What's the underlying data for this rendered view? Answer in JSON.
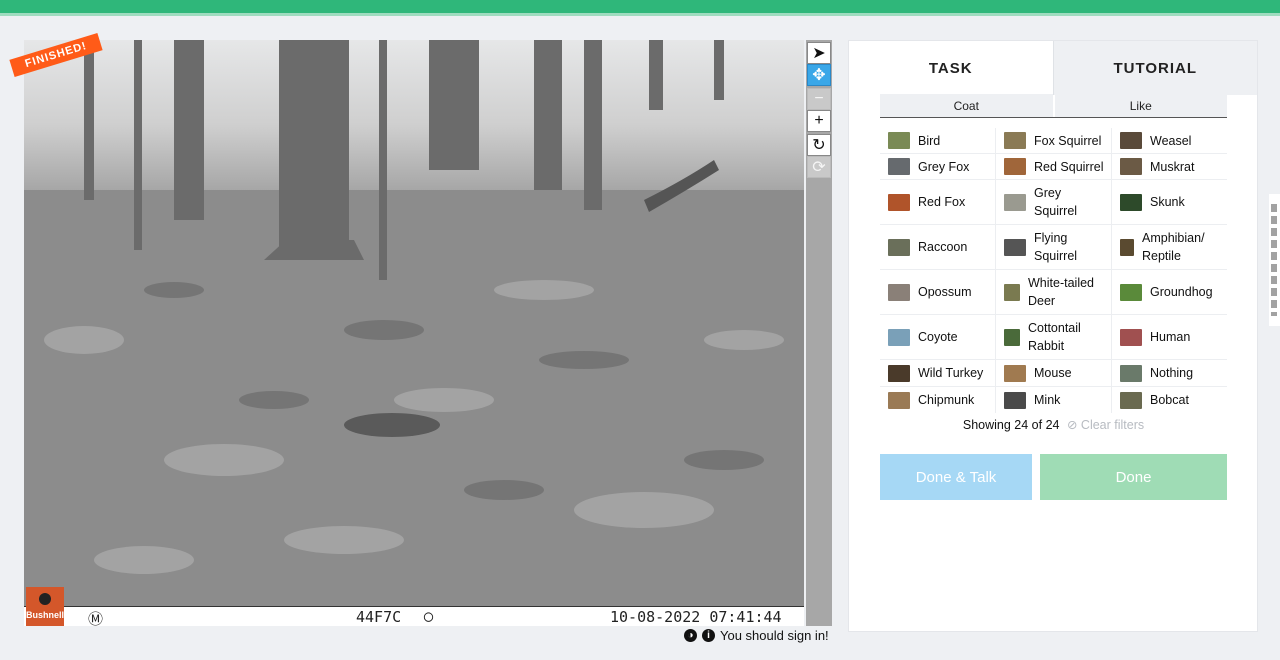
{
  "badge": {
    "finished": "FINISHED!"
  },
  "camera": {
    "brand": "Bushnell",
    "moon_left": "Ⓜ",
    "code": "44F7C",
    "moon_right": "◯",
    "timestamp": "10-08-2022 07:41:44"
  },
  "toolbar": {
    "tools": [
      {
        "name": "pointer-tool",
        "icon": "arrow-pointer-icon",
        "glyph": "➤",
        "state": "normal"
      },
      {
        "name": "move-tool",
        "icon": "move-icon",
        "glyph": "✥",
        "state": "active"
      },
      {
        "name": "zoom-out-tool",
        "icon": "minus-icon",
        "glyph": "−",
        "state": "disabled"
      },
      {
        "name": "zoom-in-tool",
        "icon": "plus-icon",
        "glyph": "+",
        "state": "normal"
      },
      {
        "name": "rotate-tool",
        "icon": "rotate-icon",
        "glyph": "↻",
        "state": "normal"
      },
      {
        "name": "reset-tool",
        "icon": "reset-icon",
        "glyph": "⟳",
        "state": "disabled"
      }
    ]
  },
  "footer": {
    "contrast_icon": "◑",
    "info_icon": "i",
    "signin": "You should sign in!"
  },
  "tabs": {
    "task": "TASK",
    "tutorial": "TUTORIAL"
  },
  "filters": {
    "coat": "Coat",
    "like": "Like"
  },
  "species": [
    [
      {
        "label": "Bird",
        "color": "#7a8a55"
      },
      {
        "label": "Fox Squirrel",
        "color": "#8a7a55"
      },
      {
        "label": "Weasel",
        "color": "#5a4a3a"
      }
    ],
    [
      {
        "label": "Grey Fox",
        "color": "#666a6e"
      },
      {
        "label": "Red Squirrel",
        "color": "#a0663a"
      },
      {
        "label": "Muskrat",
        "color": "#6b5a45"
      }
    ],
    [
      {
        "label": "Red Fox",
        "color": "#b0542a"
      },
      {
        "label": "Grey Squirrel",
        "color": "#9a9a90"
      },
      {
        "label": "Skunk",
        "color": "#2d4a2a"
      }
    ],
    [
      {
        "label": "Raccoon",
        "color": "#6a6f5a"
      },
      {
        "label": "Flying Squirrel",
        "color": "#555555"
      },
      {
        "label": "Amphibian/ Reptile",
        "color": "#5a4a30"
      }
    ],
    [
      {
        "label": "Opossum",
        "color": "#8a8078"
      },
      {
        "label": "White-tailed Deer",
        "color": "#7a7a50"
      },
      {
        "label": "Groundhog",
        "color": "#5a8a3a"
      }
    ],
    [
      {
        "label": "Coyote",
        "color": "#7aa0b8"
      },
      {
        "label": "Cottontail Rabbit",
        "color": "#4a6a3a"
      },
      {
        "label": "Human",
        "color": "#a05050"
      }
    ],
    [
      {
        "label": "Wild Turkey",
        "color": "#4a3a2a"
      },
      {
        "label": "Mouse",
        "color": "#a07a50"
      },
      {
        "label": "Nothing",
        "color": "#6a7a6a"
      }
    ],
    [
      {
        "label": "Chipmunk",
        "color": "#9a7a55"
      },
      {
        "label": "Mink",
        "color": "#4a4a4a"
      },
      {
        "label": "Bobcat",
        "color": "#6a6a50"
      }
    ]
  ],
  "showing": {
    "text": "Showing 24 of 24",
    "clear": "⊘ Clear filters"
  },
  "buttons": {
    "done_talk": "Done & Talk",
    "done": "Done"
  }
}
